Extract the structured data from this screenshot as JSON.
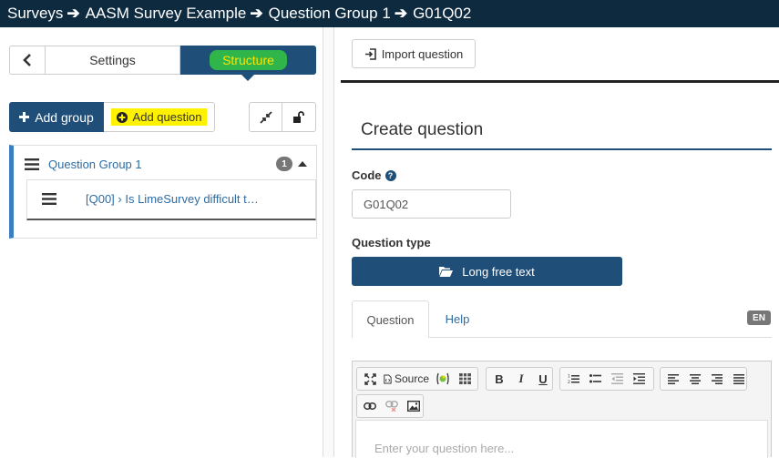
{
  "breadcrumb": {
    "items": [
      "Surveys",
      "AASM Survey Example",
      "Question Group 1",
      "G01Q02"
    ]
  },
  "sidebar": {
    "tabs": {
      "settings": "Settings",
      "structure": "Structure"
    },
    "actions": {
      "add_group": "Add group",
      "add_question": "Add question"
    },
    "group": {
      "title": "Question Group 1",
      "count": "1",
      "questions": [
        {
          "label": "[Q00] › Is LimeSurvey difficult t…"
        }
      ]
    }
  },
  "main": {
    "import_button": "Import question",
    "title": "Create question",
    "code": {
      "label": "Code",
      "value": "G01Q02"
    },
    "question_type": {
      "label": "Question type",
      "value": "Long free text"
    },
    "tabs": {
      "question": "Question",
      "help": "Help"
    },
    "language": "EN",
    "editor": {
      "source_label": "Source",
      "placeholder": "Enter your question here..."
    }
  },
  "colors": {
    "topbar": "#0e2a3f",
    "primary": "#1f4e79",
    "link": "#2e6ca4",
    "highlight_yellow": "#fff200",
    "highlight_green": "#2fb54a"
  }
}
